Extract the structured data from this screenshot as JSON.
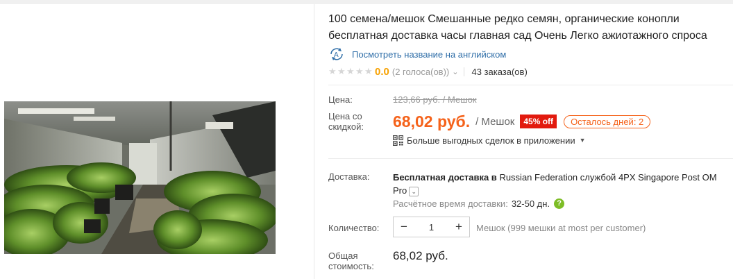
{
  "product": {
    "title_line1": "100 семена/мешок Смешанные редко семян, органические конопли",
    "title_line2": "бесплатная доставка часы главная сад Очень Легко ажиотажного спроса",
    "translate_link": "Посмотреть название на английском",
    "translate_icon_text": "А",
    "rating_value": "0.0",
    "votes": "(2 голоса(ов))",
    "orders": "43 заказа(ов)"
  },
  "pricing": {
    "price_label": "Цена:",
    "old_price": "123,66 руб. / Мешок",
    "discount_price_label": "Цена со скидкой:",
    "new_price": "68,02 руб.",
    "unit": "/ Мешок",
    "discount_badge": "45% off",
    "days_left": "Осталось дней: 2",
    "app_deals": "Больше выгодных сделок в приложении"
  },
  "shipping": {
    "label": "Доставка:",
    "free_shipping": "Бесплатная доставка в",
    "destination": "Russian Federation",
    "carrier_prefix": "службой",
    "carrier_name": "4PX Singapore Post OM",
    "carrier_suffix": "Pro",
    "estimated_label": "Расчётное время доставки:",
    "estimated_days": "32-50 дн.",
    "help_icon_text": "?"
  },
  "quantity": {
    "label": "Количество:",
    "minus": "−",
    "value": "1",
    "plus": "+",
    "note": "Мешок (999 мешки at most per customer)"
  },
  "total": {
    "label": "Общая стоимость:",
    "value": "68,02 руб."
  },
  "colors": {
    "accent_orange": "#f5621a",
    "rating_orange": "#f7a100",
    "discount_red": "#e21a0e",
    "link_blue": "#2f6ea8",
    "help_green": "#7dbd26"
  }
}
